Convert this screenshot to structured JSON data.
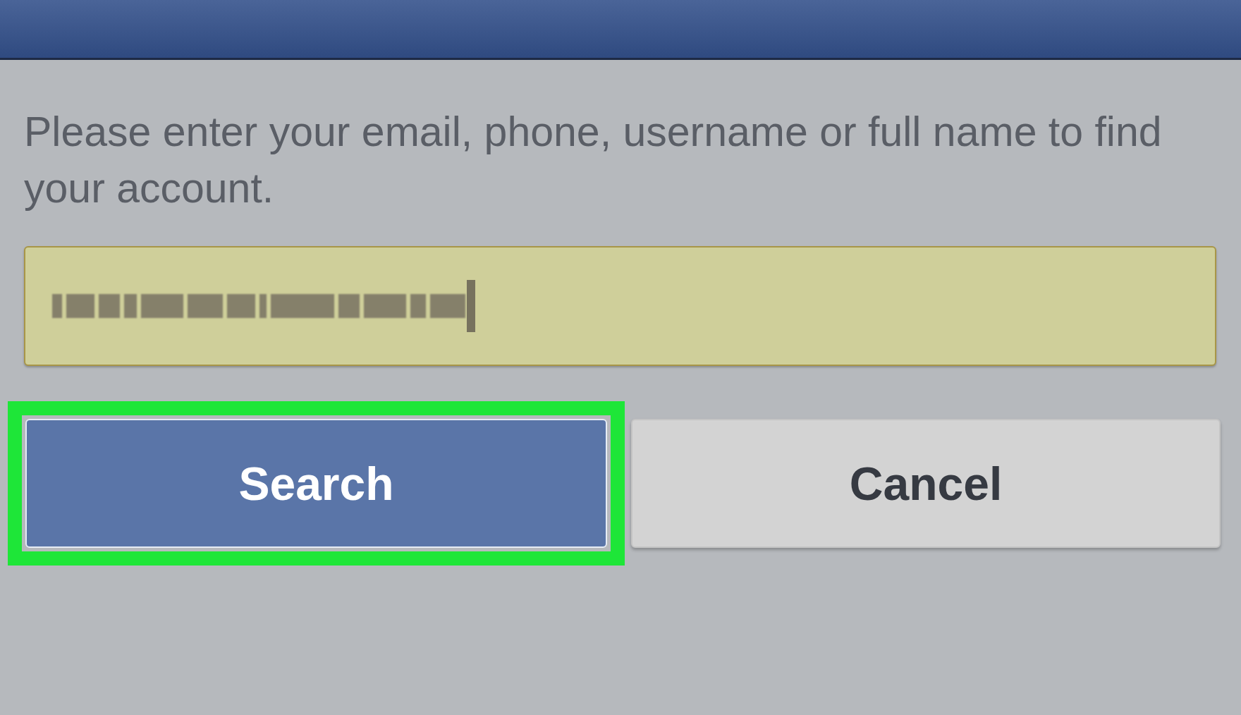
{
  "instructions": "Please enter your email, phone, username or full name to find your account.",
  "field": {
    "kind": "redacted",
    "focused": true
  },
  "buttons": [
    {
      "label": "Search",
      "kind": "primary",
      "highlighted": true
    },
    {
      "label": "Cancel",
      "kind": "secondary",
      "highlighted": false
    }
  ]
}
